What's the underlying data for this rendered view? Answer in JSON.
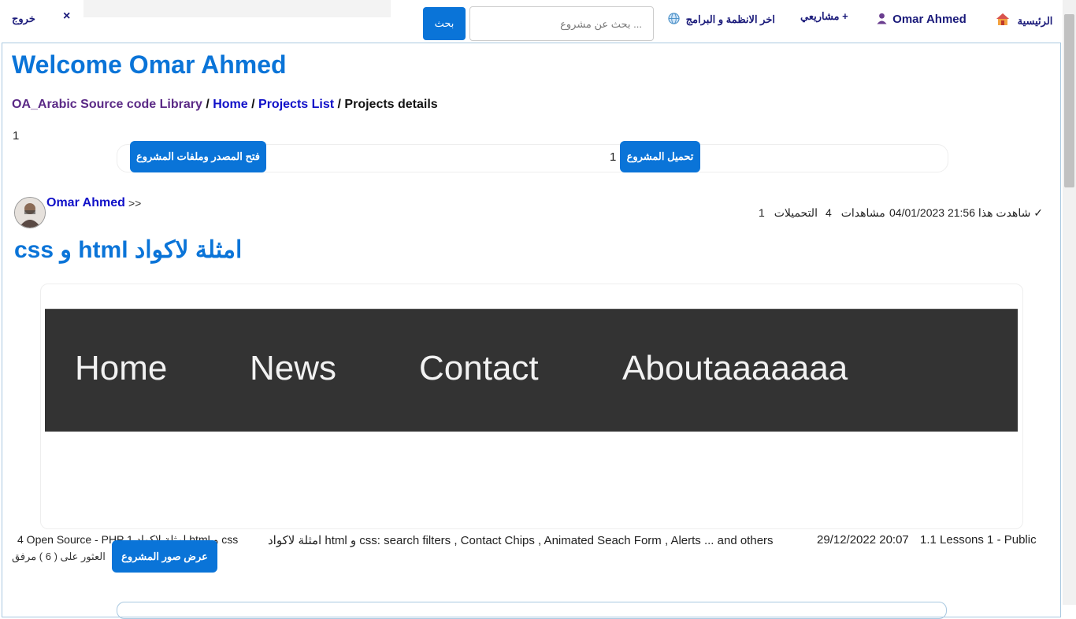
{
  "nav": {
    "logout_label": "خروج",
    "close_symbol": "×",
    "search_button": "بحث",
    "search_placeholder": "... بحث عن مشروع",
    "latest_systems": "اخر الانظمة و البرامج",
    "my_projects": "مشاريعي +",
    "user_name": "Omar Ahmed",
    "home_label": "الرئيسية"
  },
  "page": {
    "welcome": "Welcome Omar Ahmed",
    "breadcrumb": {
      "library": "OA_Arabic Source code Library",
      "home": "Home",
      "projects_list": "Projects List",
      "current": "Projects details",
      "separator": "/"
    },
    "counter": "1"
  },
  "actions": {
    "open_source_files": "فتح المصدر وملفات المشروع",
    "download_project": "تحميل المشروع",
    "download_count": "1",
    "view_images": "عرض صور المشروع"
  },
  "project": {
    "author": "Omar Ahmed",
    "author_suffix": ">>",
    "seen_label": "شاهدت هذا ✓",
    "date_time": "04/01/2023 21:56",
    "views_label": "مشاهدات",
    "views_count": "4",
    "downloads_label": "التحميلات",
    "downloads_count": "1",
    "title": "امثلة لاكواد html و css",
    "preview_links": [
      "Home",
      "News",
      "Contact",
      "Aboutaaaaaaa"
    ],
    "created": "29/12/2022 20:07",
    "meta_right": "1.1 Lessons 1 - Public",
    "description": "امثلة لاكواد html و css: search filters , Contact Chips , Animated Seach Form , Alerts ... and others",
    "meta_left": "4 Open Source - PHP 1 امثلة لاكواد html و css",
    "attachments": "العثور على ( 6 ) مرفق"
  }
}
